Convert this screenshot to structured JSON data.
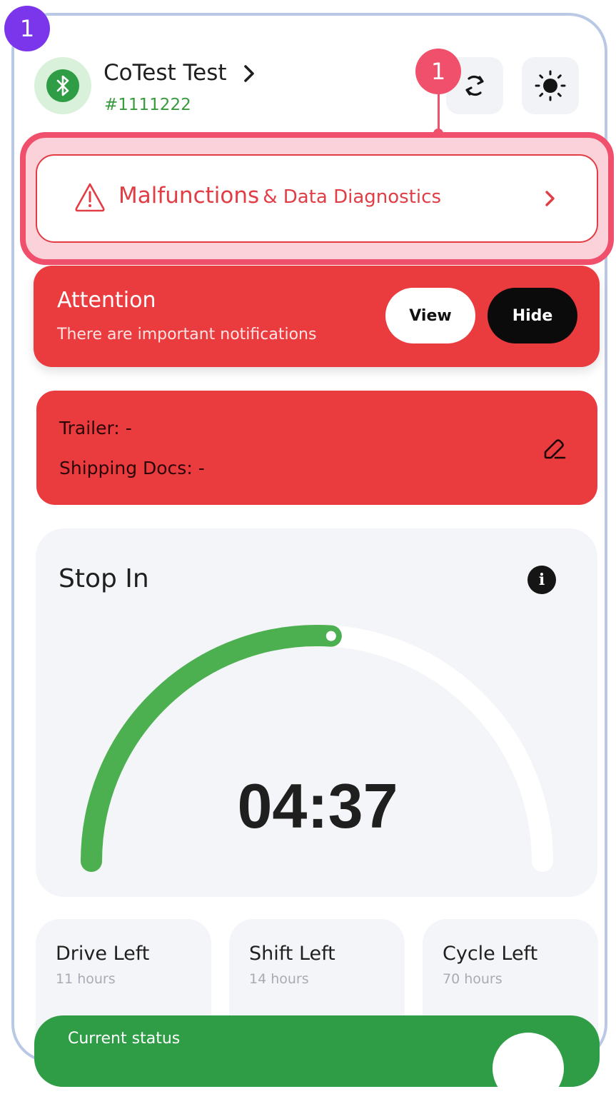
{
  "step_badge": "1",
  "hotspot_badge": "1",
  "device": {
    "name": "CoTest Test",
    "id": "#1111222"
  },
  "diagnostics": {
    "title_main": "Malfunctions",
    "title_rest": "& Data Diagnostics"
  },
  "attention": {
    "title": "Attention",
    "subtitle": "There are important notifications",
    "view_label": "View",
    "hide_label": "Hide"
  },
  "trailer": {
    "trailer_label": "Trailer:",
    "trailer_value": "-",
    "docs_label": "Shipping Docs:",
    "docs_value": "-"
  },
  "stop": {
    "title": "Stop In",
    "timer": "04:37",
    "progress_fraction": 0.52
  },
  "limits": [
    {
      "title": "Drive Left",
      "value": "11 hours"
    },
    {
      "title": "Shift Left",
      "value": "14 hours"
    },
    {
      "title": "Cycle Left",
      "value": "70 hours"
    }
  ],
  "status": {
    "label": "Current status"
  },
  "colors": {
    "accent_green": "#2f9d46",
    "alert_red": "#ea3b3f",
    "highlight_pink": "#f0506c",
    "step_purple": "#7b35ea",
    "gauge_green": "#4caf50"
  },
  "icons": [
    "bluetooth-icon",
    "chevron-right-icon",
    "sync-icon",
    "brightness-icon",
    "warning-triangle-icon",
    "pencil-icon",
    "info-icon"
  ]
}
